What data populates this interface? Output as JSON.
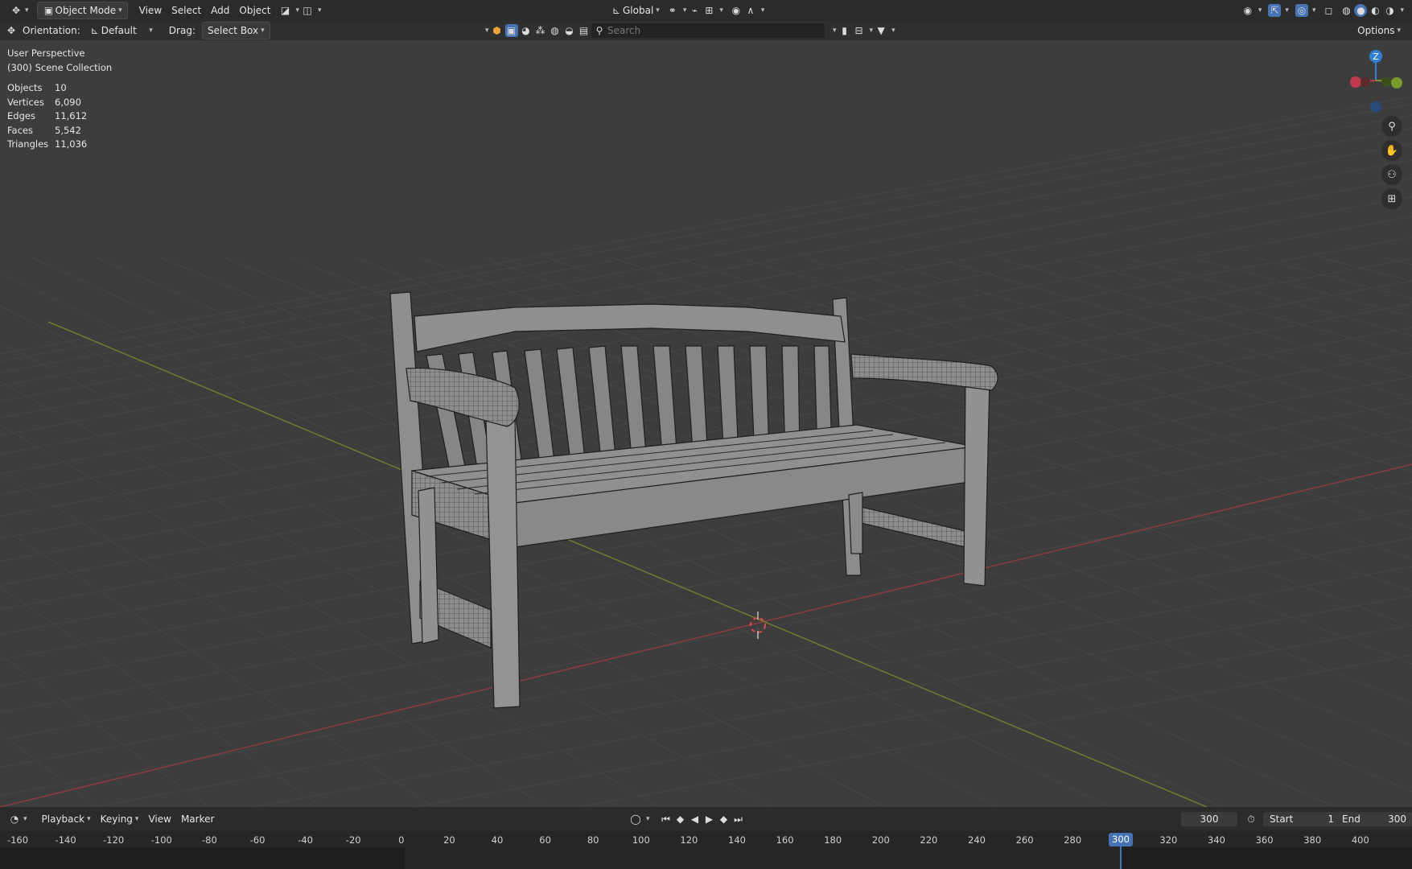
{
  "header": {
    "editor_icon": "move-icon",
    "mode_label": "Object Mode",
    "menus": [
      "View",
      "Select",
      "Add",
      "Object"
    ],
    "transform_orientation": "Global"
  },
  "toolrow": {
    "orientation_label": "Orientation:",
    "orientation_value": "Default",
    "drag_label": "Drag:",
    "drag_value": "Select Box",
    "search_placeholder": "Search",
    "options_label": "Options"
  },
  "viewport": {
    "view_name": "User Perspective",
    "collection": "(300) Scene Collection",
    "stats": [
      {
        "label": "Objects",
        "value": "10"
      },
      {
        "label": "Vertices",
        "value": "6,090"
      },
      {
        "label": "Edges",
        "value": "11,612"
      },
      {
        "label": "Faces",
        "value": "5,542"
      },
      {
        "label": "Triangles",
        "value": "11,036"
      }
    ],
    "gizmo_axis_label": "Z",
    "colors": {
      "x_axis": "#c0394c",
      "y_axis": "#7a9a2a",
      "z_axis": "#2f7ed8",
      "mesh": "#8a8a8a"
    }
  },
  "timeline": {
    "menus": [
      "Playback",
      "Keying",
      "View",
      "Marker"
    ],
    "current_frame": "300",
    "start_label": "Start",
    "start_value": "1",
    "end_label": "End",
    "end_value": "300",
    "ruler_ticks": [
      "-160",
      "-140",
      "-120",
      "-100",
      "-80",
      "-60",
      "-40",
      "-20",
      "0",
      "20",
      "40",
      "60",
      "80",
      "100",
      "120",
      "140",
      "160",
      "180",
      "200",
      "220",
      "240",
      "260",
      "280",
      "300",
      "320",
      "340",
      "360",
      "380",
      "400"
    ],
    "playhead_label": "300"
  }
}
